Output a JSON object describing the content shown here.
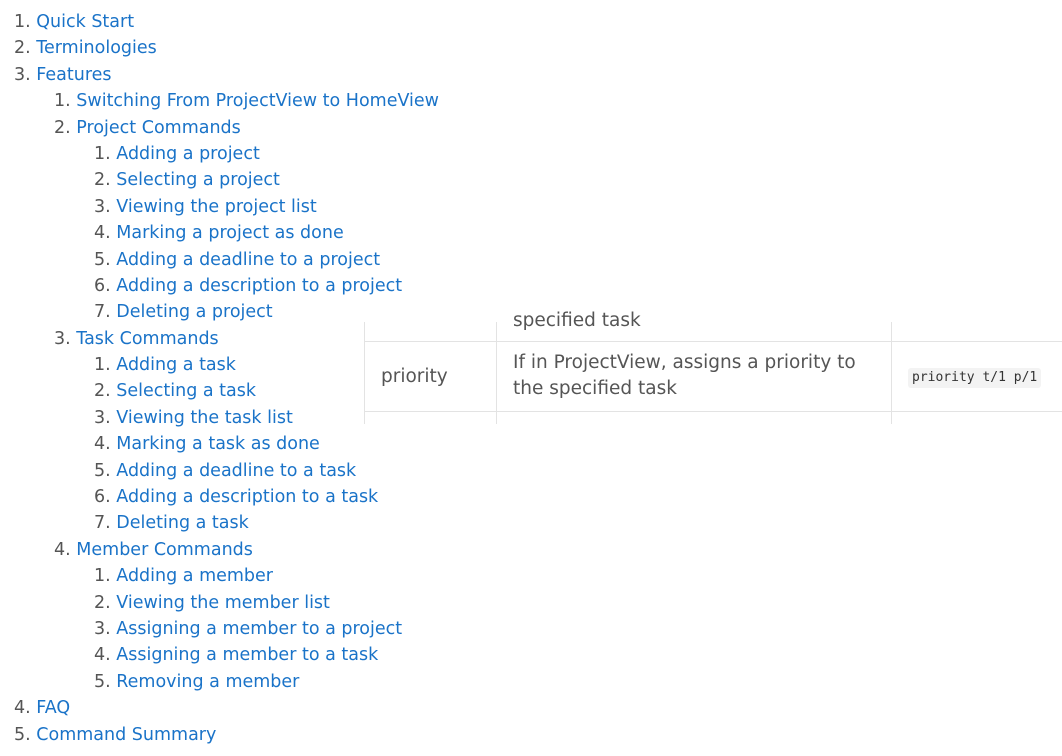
{
  "toc": [
    {
      "num": "1.",
      "label": "Quick Start",
      "level": 1
    },
    {
      "num": "2.",
      "label": "Terminologies",
      "level": 1
    },
    {
      "num": "3.",
      "label": "Features",
      "level": 1
    },
    {
      "num": "1.",
      "label": "Switching From ProjectView to HomeView",
      "level": 2
    },
    {
      "num": "2.",
      "label": "Project Commands",
      "level": 2
    },
    {
      "num": "1.",
      "label": "Adding a project",
      "level": 3
    },
    {
      "num": "2.",
      "label": "Selecting a project",
      "level": 3
    },
    {
      "num": "3.",
      "label": "Viewing the project list",
      "level": 3
    },
    {
      "num": "4.",
      "label": "Marking a project as done",
      "level": 3
    },
    {
      "num": "5.",
      "label": "Adding a deadline to a project",
      "level": 3
    },
    {
      "num": "6.",
      "label": "Adding a description to a project",
      "level": 3
    },
    {
      "num": "7.",
      "label": "Deleting a project",
      "level": 3
    },
    {
      "num": "3.",
      "label": "Task Commands",
      "level": 2
    },
    {
      "num": "1.",
      "label": "Adding a task",
      "level": 3
    },
    {
      "num": "2.",
      "label": "Selecting a task",
      "level": 3
    },
    {
      "num": "3.",
      "label": "Viewing the task list",
      "level": 3
    },
    {
      "num": "4.",
      "label": "Marking a task as done",
      "level": 3
    },
    {
      "num": "5.",
      "label": "Adding a deadline to a task",
      "level": 3
    },
    {
      "num": "6.",
      "label": "Adding a description to a task",
      "level": 3
    },
    {
      "num": "7.",
      "label": "Deleting a task",
      "level": 3
    },
    {
      "num": "4.",
      "label": "Member Commands",
      "level": 2
    },
    {
      "num": "1.",
      "label": "Adding a member",
      "level": 3
    },
    {
      "num": "2.",
      "label": "Viewing the member list",
      "level": 3
    },
    {
      "num": "3.",
      "label": "Assigning a member to a project",
      "level": 3
    },
    {
      "num": "4.",
      "label": "Assigning a member to a task",
      "level": 3
    },
    {
      "num": "5.",
      "label": "Removing a member",
      "level": 3
    },
    {
      "num": "4.",
      "label": "FAQ",
      "level": 1
    },
    {
      "num": "5.",
      "label": "Command Summary",
      "level": 1
    }
  ],
  "table": {
    "cut_text": "specified task",
    "row": {
      "command": "priority",
      "description": "If in ProjectView, assigns a priority to the specified task",
      "format": "priority t/1 p/1"
    }
  },
  "colors": {
    "link": "#1a73c8",
    "text": "#555555",
    "border": "#e3e3e3"
  }
}
